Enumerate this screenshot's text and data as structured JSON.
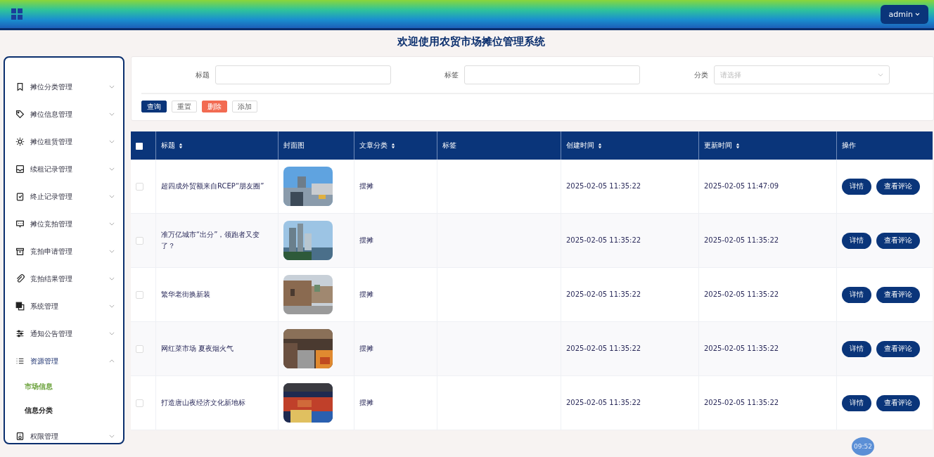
{
  "top_bar": {
    "user_menu": "admin"
  },
  "page_title": "欢迎使用农贸市场摊位管理系统",
  "sidebar": {
    "items": [
      {
        "label": "摊位分类管理",
        "expanded": false
      },
      {
        "label": "摊位信息管理",
        "expanded": false
      },
      {
        "label": "摊位租赁管理",
        "expanded": false
      },
      {
        "label": "续租记录管理",
        "expanded": false
      },
      {
        "label": "终止记录管理",
        "expanded": false
      },
      {
        "label": "摊位竞拍管理",
        "expanded": false
      },
      {
        "label": "竞拍申请管理",
        "expanded": false
      },
      {
        "label": "竞拍结果管理",
        "expanded": false
      },
      {
        "label": "系统管理",
        "expanded": false
      },
      {
        "label": "通知公告管理",
        "expanded": false
      },
      {
        "label": "资源管理",
        "expanded": true,
        "children": [
          {
            "label": "市场信息",
            "selected": true
          },
          {
            "label": "信息分类",
            "selected": false
          }
        ]
      },
      {
        "label": "权限管理",
        "expanded": false
      }
    ]
  },
  "search": {
    "fields": [
      {
        "label": "标题",
        "kind": "text"
      },
      {
        "label": "标签",
        "kind": "text"
      },
      {
        "label": "分类",
        "kind": "select",
        "placeholder": "请选择"
      }
    ],
    "buttons": [
      {
        "label": "查询",
        "kind": "primary"
      },
      {
        "label": "重置",
        "kind": "default"
      },
      {
        "label": "删除",
        "kind": "danger"
      },
      {
        "label": "添加",
        "kind": "default"
      }
    ]
  },
  "table": {
    "select_all": {
      "checked": false
    },
    "columns": [
      {
        "label": "标题",
        "sortable": true
      },
      {
        "label": "封面图",
        "sortable": false
      },
      {
        "label": "文章分类",
        "sortable": true
      },
      {
        "label": "标签",
        "sortable": false
      },
      {
        "label": "创建时间",
        "sortable": true
      },
      {
        "label": "更新时间",
        "sortable": true
      },
      {
        "label": "操作",
        "sortable": false
      }
    ],
    "rows": [
      {
        "checked": false,
        "title": "超四成外贸额来自RCEP“朋友圈”",
        "cover": {
          "kind": "picture"
        },
        "category": "摆摊",
        "created": "2025-02-05 11:35:22",
        "updated": "2025-02-05 11:47:09",
        "actions": [
          "详情",
          "查看评论"
        ]
      },
      {
        "checked": false,
        "title": "准万亿城市“出分”，领跑者又变了？",
        "cover": {
          "kind": "picture"
        },
        "category": "摆摊",
        "created": "2025-02-05 11:35:22",
        "updated": "2025-02-05 11:35:22",
        "actions": [
          "详情",
          "查看评论"
        ]
      },
      {
        "checked": false,
        "title": "繁华老街换新装",
        "cover": {
          "kind": "picture"
        },
        "category": "摆摊",
        "created": "2025-02-05 11:35:22",
        "updated": "2025-02-05 11:35:22",
        "actions": [
          "详情",
          "查看评论"
        ]
      },
      {
        "checked": false,
        "title": "网红菜市场 夏夜烟火气",
        "cover": {
          "kind": "picture"
        },
        "category": "摆摊",
        "created": "2025-02-05 11:35:22",
        "updated": "2025-02-05 11:35:22",
        "actions": [
          "详情",
          "查看评论"
        ]
      },
      {
        "checked": false,
        "title": "打造唐山夜经济文化新地标",
        "cover": {
          "kind": "picture"
        },
        "category": "摆摊",
        "created": "2025-02-05 11:35:22",
        "updated": "2025-02-05 11:35:22",
        "actions": [
          "详情",
          "查看评论"
        ]
      }
    ]
  },
  "clock_badge": "09:52"
}
